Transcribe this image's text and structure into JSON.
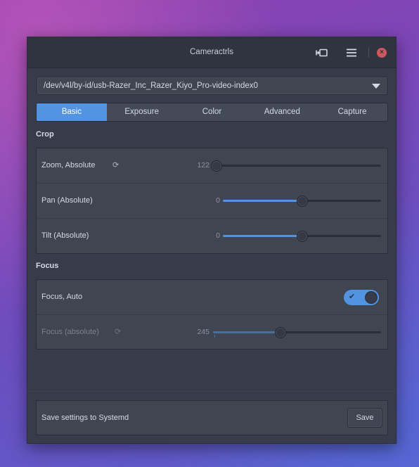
{
  "window": {
    "title": "Cameractrls"
  },
  "icons": {
    "camera": "camera-switch-icon",
    "menu": "hamburger-menu-icon",
    "close": "close-icon"
  },
  "device": {
    "selected": "/dev/v4l/by-id/usb-Razer_Inc_Razer_Kiyo_Pro-video-index0"
  },
  "tabs": [
    {
      "label": "Basic",
      "active": true
    },
    {
      "label": "Exposure",
      "active": false
    },
    {
      "label": "Color",
      "active": false
    },
    {
      "label": "Advanced",
      "active": false
    },
    {
      "label": "Capture",
      "active": false
    }
  ],
  "crop": {
    "title": "Crop",
    "zoom": {
      "label": "Zoom, Absolute",
      "value": "122",
      "fraction": 0.02
    },
    "pan": {
      "label": "Pan (Absolute)",
      "value": "0",
      "fraction": 0.5
    },
    "tilt": {
      "label": "Tilt (Absolute)",
      "value": "0",
      "fraction": 0.5
    }
  },
  "focus": {
    "title": "Focus",
    "auto": {
      "label": "Focus, Auto",
      "enabled": true
    },
    "absolute": {
      "label": "Focus (absolute)",
      "value": "245",
      "fraction": 0.4,
      "disabled": true
    }
  },
  "footer": {
    "label": "Save settings to Systemd",
    "save_label": "Save"
  },
  "colors": {
    "accent": "#5294e2",
    "window_bg": "#383c4a",
    "close": "#cc575d"
  }
}
